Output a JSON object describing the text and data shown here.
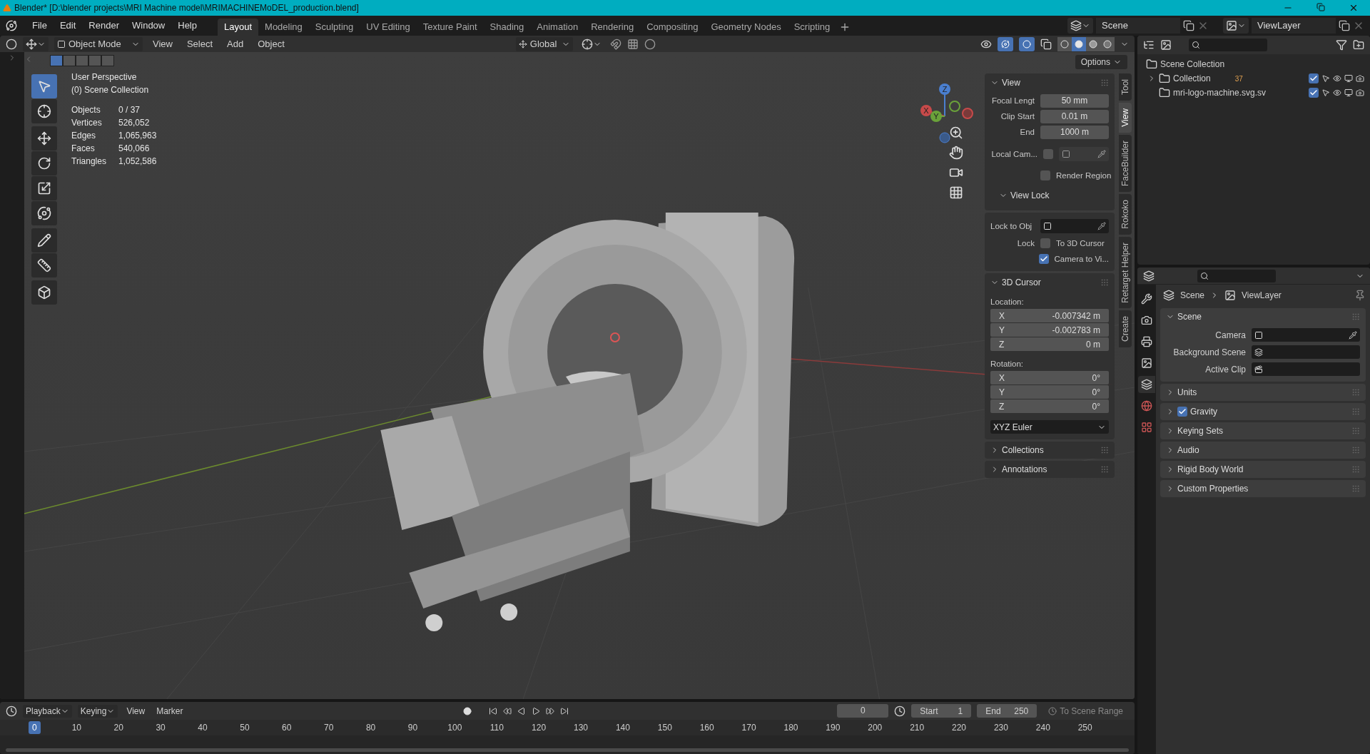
{
  "title_bar": {
    "title": "Blender* [D:\\blender projects\\MRI Machine model\\MRIMACHINEMoDEL_production.blend]"
  },
  "menu_bar": {
    "menus": [
      "File",
      "Edit",
      "Render",
      "Window",
      "Help"
    ],
    "workspaces": [
      {
        "label": "Layout",
        "selected": true
      },
      {
        "label": "Modeling",
        "selected": false
      },
      {
        "label": "Sculpting",
        "selected": false
      },
      {
        "label": "UV Editing",
        "selected": false
      },
      {
        "label": "Texture Paint",
        "selected": false
      },
      {
        "label": "Shading",
        "selected": false
      },
      {
        "label": "Animation",
        "selected": false
      },
      {
        "label": "Rendering",
        "selected": false
      },
      {
        "label": "Compositing",
        "selected": false
      },
      {
        "label": "Geometry Nodes",
        "selected": false
      },
      {
        "label": "Scripting",
        "selected": false
      }
    ],
    "scene": "Scene",
    "view_layer": "ViewLayer"
  },
  "viewport_header": {
    "mode": "Object Mode",
    "menus": [
      "View",
      "Select",
      "Add",
      "Object"
    ],
    "orientation": "Global",
    "options": "Options",
    "toggles": [
      {
        "kind": "gizmo",
        "on": true
      },
      {
        "kind": "overlay",
        "on": true
      }
    ],
    "shading": [
      {
        "kind": "wireframe",
        "selected": false
      },
      {
        "kind": "solid",
        "selected": true
      },
      {
        "kind": "material",
        "selected": false
      },
      {
        "kind": "rendered",
        "selected": false
      }
    ],
    "select_modes": [
      {
        "selected": true
      },
      {
        "selected": false
      },
      {
        "selected": false
      },
      {
        "selected": false
      },
      {
        "selected": false
      }
    ]
  },
  "viewport": {
    "overlay_lines": [
      "User Perspective",
      "(0) Scene Collection"
    ],
    "stats": [
      {
        "label": "Objects",
        "value": "0 / 37"
      },
      {
        "label": "Vertices",
        "value": "526,052"
      },
      {
        "label": "Edges",
        "value": "1,065,963"
      },
      {
        "label": "Faces",
        "value": "540,066"
      },
      {
        "label": "Triangles",
        "value": "1,052,586"
      }
    ],
    "tools": [
      {
        "kind": "select",
        "selected": true
      },
      {
        "kind": "cursor",
        "selected": false
      },
      {
        "kind": "move",
        "selected": false
      },
      {
        "kind": "rotate",
        "selected": false
      },
      {
        "kind": "scale",
        "selected": false
      },
      {
        "kind": "transform",
        "selected": false
      },
      {
        "kind": "annotate",
        "selected": false
      },
      {
        "kind": "measure",
        "selected": false
      },
      {
        "kind": "add-cube",
        "selected": false
      }
    ],
    "gizmo_axes": [
      "X",
      "Y",
      "Z"
    ]
  },
  "sidebar": {
    "tabs": [
      {
        "label": "Tool",
        "selected": false
      },
      {
        "label": "View",
        "selected": true
      },
      {
        "label": "FaceBuilder",
        "selected": false
      },
      {
        "label": "Rokoko",
        "selected": false
      },
      {
        "label": "Retarget Helper",
        "selected": false
      },
      {
        "label": "Create",
        "selected": false
      }
    ],
    "view_panel": {
      "title": "View",
      "expanded": true,
      "fields": [
        {
          "label": "Focal Lengt",
          "value": "50 mm"
        },
        {
          "label": "Clip Start",
          "value": "0.01 m"
        },
        {
          "label": "End",
          "value": "1000 m"
        }
      ],
      "local_camera": {
        "label": "Local Cam...",
        "checked": false
      },
      "render_region": {
        "label": "Render Region",
        "checked": false
      }
    },
    "view_lock": {
      "title": "View Lock",
      "expanded": true,
      "lock_to_object": "Lock to Obj",
      "lock_label": "Lock",
      "options": [
        {
          "label": "To 3D Cursor",
          "checked": false
        },
        {
          "label": "Camera to Vi...",
          "checked": true
        }
      ]
    },
    "cursor_panel": {
      "title": "3D Cursor",
      "expanded": true,
      "location_label": "Location:",
      "location": [
        {
          "axis": "X",
          "value": "-0.007342 m"
        },
        {
          "axis": "Y",
          "value": "-0.002783 m"
        },
        {
          "axis": "Z",
          "value": "0 m"
        }
      ],
      "rotation_label": "Rotation:",
      "rotation": [
        {
          "axis": "X",
          "value": "0°"
        },
        {
          "axis": "Y",
          "value": "0°"
        },
        {
          "axis": "Z",
          "value": "0°"
        }
      ],
      "rotation_mode": "XYZ Euler"
    },
    "other_panels": [
      {
        "title": "Collections",
        "expanded": false
      },
      {
        "title": "Annotations",
        "expanded": false
      }
    ]
  },
  "outliner": {
    "root": "Scene Collection",
    "items": [
      {
        "name": "Collection",
        "expanded": false,
        "badge": "37",
        "checked": true
      },
      {
        "name": "mri-logo-machine.svg.sv",
        "checked": true
      }
    ]
  },
  "properties": {
    "tabs": [
      {
        "kind": "tool",
        "selected": false
      },
      {
        "kind": "render",
        "selected": false
      },
      {
        "kind": "output",
        "selected": false
      },
      {
        "kind": "view-layer",
        "selected": false
      },
      {
        "kind": "scene",
        "selected": true
      },
      {
        "kind": "world",
        "selected": false
      },
      {
        "kind": "texture",
        "selected": false
      }
    ],
    "breadcrumb": [
      "Scene",
      "ViewLayer"
    ],
    "panels": [
      {
        "title": "Scene",
        "expanded": true,
        "fields": [
          {
            "label": "Camera",
            "kind": "camera"
          },
          {
            "label": "Background Scene",
            "kind": "scene"
          },
          {
            "label": "Active Clip",
            "kind": "clip"
          }
        ]
      },
      {
        "title": "Units",
        "expanded": false
      },
      {
        "title": "Gravity",
        "expanded": false,
        "checked": true
      },
      {
        "title": "Keying Sets",
        "expanded": false
      },
      {
        "title": "Audio",
        "expanded": false
      },
      {
        "title": "Rigid Body World",
        "expanded": false
      },
      {
        "title": "Custom Properties",
        "expanded": false
      }
    ]
  },
  "timeline": {
    "menus": [
      {
        "label": "Playback",
        "dropdown": true
      },
      {
        "label": "Keying",
        "dropdown": true
      },
      {
        "label": "View",
        "dropdown": false
      },
      {
        "label": "Marker",
        "dropdown": false
      }
    ],
    "current_frame": "0",
    "start_label": "Start",
    "start": "1",
    "end_label": "End",
    "end": "250",
    "range_label": "To Scene Range",
    "playhead": "0",
    "ticks": [
      "10",
      "20",
      "30",
      "40",
      "50",
      "60",
      "70",
      "80",
      "90",
      "100",
      "110",
      "120",
      "130",
      "140",
      "150",
      "160",
      "170",
      "180",
      "190",
      "200",
      "210",
      "220",
      "230",
      "240",
      "250"
    ]
  }
}
